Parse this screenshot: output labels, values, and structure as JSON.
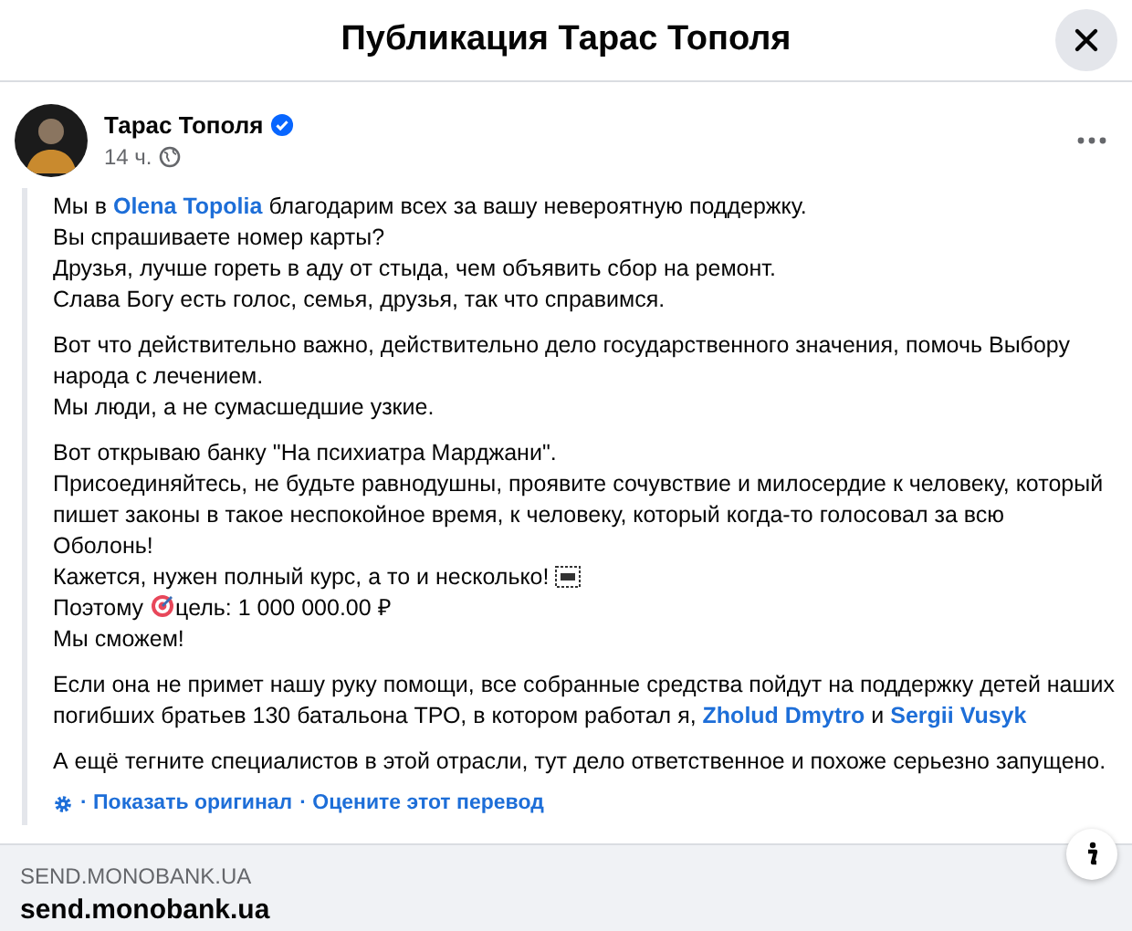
{
  "dialog": {
    "title": "Публикация Тарас Тополя"
  },
  "post": {
    "author": "Тарас Тополя",
    "verified": true,
    "time": "14 ч.",
    "paragraphs": [
      [
        [
          {
            "kind": "text",
            "text": "Мы в "
          },
          {
            "kind": "link",
            "text": "Olena Topolia"
          },
          {
            "kind": "text",
            "text": " благодарим всех за вашу невероятную поддержку."
          }
        ],
        [
          {
            "kind": "text",
            "text": "Вы спрашиваете номер карты?"
          }
        ],
        [
          {
            "kind": "text",
            "text": "Друзья, лучше гореть в аду от стыда, чем объявить сбор на ремонт."
          }
        ],
        [
          {
            "kind": "text",
            "text": "Слава Богу есть голос, семья, друзья, так что справимся."
          }
        ]
      ],
      [
        [
          {
            "kind": "text",
            "text": "Вот что действительно важно, действительно дело государственного значения, помочь Выбору"
          }
        ],
        [
          {
            "kind": "text",
            "text": "народа с лечением."
          }
        ],
        [
          {
            "kind": "text",
            "text": "Мы люди, а не сумасшедшие узкие."
          }
        ]
      ],
      [
        [
          {
            "kind": "text",
            "text": "Вот открываю банку \"На психиатра Марджани\"."
          }
        ],
        [
          {
            "kind": "text",
            "text": "Присоединяйтесь, не будьте равнодушны, проявите сочувствие и милосердие к человеку, который"
          }
        ],
        [
          {
            "kind": "text",
            "text": "пишет законы в такое неспокойное время, к человеку, который когда-то голосовал за всю"
          }
        ],
        [
          {
            "kind": "text",
            "text": "Оболонь!"
          }
        ],
        [
          {
            "kind": "text",
            "text": "Кажется, нужен полный курс, а то и несколько! "
          },
          {
            "kind": "glyph"
          }
        ],
        [
          {
            "kind": "text",
            "text": "Поэтому "
          },
          {
            "kind": "target"
          },
          {
            "kind": "text",
            "text": "цель: 1 000 000.00 ₽"
          }
        ],
        [
          {
            "kind": "text",
            "text": "Мы сможем!"
          }
        ]
      ],
      [
        [
          {
            "kind": "text",
            "text": "Если она не примет нашу руку помощи, все собранные средства пойдут на поддержку детей наших"
          }
        ],
        [
          {
            "kind": "text",
            "text": "погибших братьев 130 батальона ТРО, в котором работал я, "
          },
          {
            "kind": "link",
            "text": "Zholud Dmytro"
          },
          {
            "kind": "text",
            "text": " и "
          },
          {
            "kind": "link",
            "text": "Sergii Vusyk"
          }
        ]
      ],
      [
        [
          {
            "kind": "text",
            "text": "А ещё тегните специалистов в этой отрасли, тут дело ответственное и похоже серьезно запущено."
          }
        ]
      ]
    ],
    "translation": {
      "show_original": "· Показать оригинал",
      "rate": "· Оцените этот перевод"
    }
  },
  "link_preview": {
    "domain": "SEND.MONOBANK.UA",
    "title": "send.monobank.ua"
  }
}
